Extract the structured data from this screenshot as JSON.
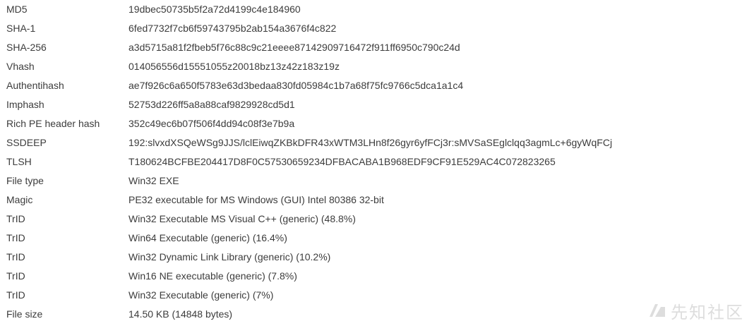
{
  "rows": [
    {
      "key": "MD5",
      "value": "19dbec50735b5f2a72d4199c4e184960"
    },
    {
      "key": "SHA-1",
      "value": "6fed7732f7cb6f59743795b2ab154a3676f4c822"
    },
    {
      "key": "SHA-256",
      "value": "a3d5715a81f2fbeb5f76c88c9c21eeee87142909716472f911ff6950c790c24d"
    },
    {
      "key": "Vhash",
      "value": "014056556d15551055z20018bz13z42z183z19z"
    },
    {
      "key": "Authentihash",
      "value": "ae7f926c6a650f5783e63d3bedaa830fd05984c1b7a68f75fc9766c5dca1a1c4"
    },
    {
      "key": "Imphash",
      "value": "52753d226ff5a8a88caf9829928cd5d1"
    },
    {
      "key": "Rich PE header hash",
      "value": "352c49ec6b07f506f4dd94c08f3e7b9a"
    },
    {
      "key": "SSDEEP",
      "value": "192:slvxdXSQeWSg9JJS/lclEiwqZKBkDFR43xWTM3LHn8f26gyr6yfFCj3r:sMVSaSEglclqq3agmLc+6gyWqFCj"
    },
    {
      "key": "TLSH",
      "value": "T180624BCFBE204417D8F0C57530659234DFBACABA1B968EDF9CF91E529AC4C072823265"
    },
    {
      "key": "File type",
      "value": "Win32 EXE"
    },
    {
      "key": "Magic",
      "value": "PE32 executable for MS Windows (GUI) Intel 80386 32-bit"
    },
    {
      "key": "TrID",
      "value": "Win32 Executable MS Visual C++ (generic) (48.8%)"
    },
    {
      "key": "TrID",
      "value": "Win64 Executable (generic) (16.4%)"
    },
    {
      "key": "TrID",
      "value": "Win32 Dynamic Link Library (generic) (10.2%)"
    },
    {
      "key": "TrID",
      "value": "Win16 NE executable (generic) (7.8%)"
    },
    {
      "key": "TrID",
      "value": "Win32 Executable (generic) (7%)"
    },
    {
      "key": "File size",
      "value": "14.50 KB (14848 bytes)"
    }
  ],
  "watermark": {
    "text": "先知社区",
    "icon": "xianzhi-logo-icon"
  },
  "colors": {
    "text": "#3c3c3c",
    "background": "#ffffff",
    "watermark": "#6a6a6a"
  }
}
